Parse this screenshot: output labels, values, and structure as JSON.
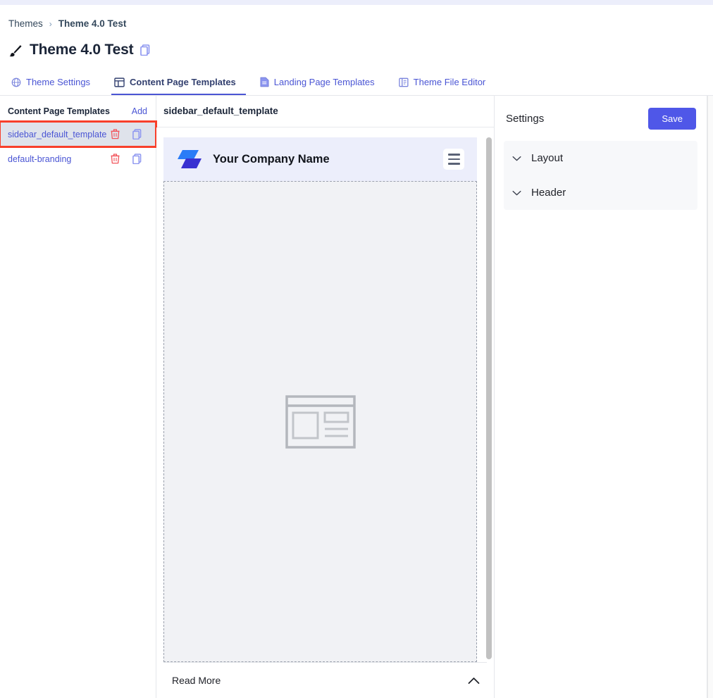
{
  "breadcrumb": {
    "root": "Themes",
    "separator": "›",
    "current": "Theme 4.0 Test"
  },
  "header": {
    "title": "Theme 4.0 Test",
    "brush_icon": "brush-icon",
    "copy_icon": "copy-icon"
  },
  "tabs": [
    {
      "label": "Theme Settings",
      "icon": "globe-icon",
      "active": false
    },
    {
      "label": "Content Page Templates",
      "icon": "layout-icon",
      "active": true
    },
    {
      "label": "Landing Page Templates",
      "icon": "document-icon",
      "active": false
    },
    {
      "label": "Theme File Editor",
      "icon": "code-file-icon",
      "active": false
    }
  ],
  "left_panel": {
    "title": "Content Page Templates",
    "add_label": "Add",
    "rows": [
      {
        "name": "sidebar_default_template",
        "selected": true,
        "delete_icon": "trash-icon",
        "copy_icon": "copy-icon"
      },
      {
        "name": "default-branding",
        "selected": false,
        "delete_icon": "trash-icon",
        "copy_icon": "copy-icon"
      }
    ]
  },
  "preview": {
    "header_title": "sidebar_default_template",
    "company_name": "Your Company Name",
    "logo_icon": "company-logo-icon",
    "menu_icon": "hamburger-menu-icon",
    "placeholder_icon": "page-layout-placeholder-icon",
    "read_more_label": "Read More",
    "collapse_icon": "chevron-up-icon"
  },
  "settings": {
    "title": "Settings",
    "save_label": "Save",
    "sections": [
      {
        "label": "Layout",
        "icon": "chevron-down-icon"
      },
      {
        "label": "Header",
        "icon": "chevron-down-icon"
      }
    ]
  },
  "colors": {
    "accent": "#4f57e8",
    "link": "#4a55d4",
    "highlight_outline": "#f8402b",
    "preview_header_bg": "#eceefb",
    "logo_light": "#2a7cf7",
    "logo_dark": "#3931d1",
    "trash": "#f2545b"
  }
}
